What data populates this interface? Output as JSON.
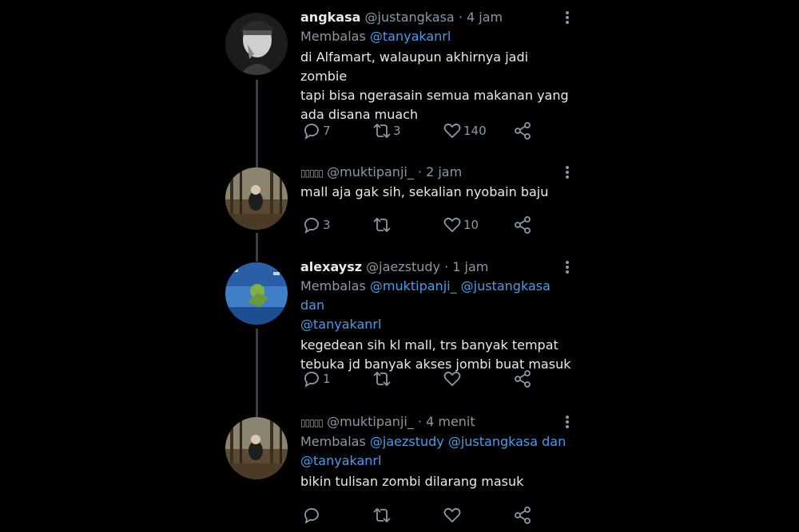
{
  "tweets": [
    {
      "name": "angkasa",
      "handle": "@justangkasa",
      "time": "· 4 jam",
      "reply_prefix": "Membalas",
      "mentions": "@tanyakanrl",
      "mentions_line2": "",
      "text_lines": [
        "di Alfamart, walaupun akhirnya jadi zombie",
        "tapi bisa ngerasain semua makanan yang",
        "ada disana muach"
      ],
      "replies": "7",
      "retweets": "3",
      "likes": "140"
    },
    {
      "name": "▯▯▯▯▯",
      "handle": "@muktipanji_",
      "time": "· 2 jam",
      "reply_prefix": "",
      "mentions": "",
      "mentions_line2": "",
      "text_lines": [
        "mall aja gak sih, sekalian nyobain baju"
      ],
      "replies": "3",
      "retweets": "",
      "likes": "10"
    },
    {
      "name": "alexaysz",
      "handle": "@jaezstudy",
      "time": "· 1 jam",
      "reply_prefix": "Membalas",
      "mentions": "@muktipanji_ @justangkasa dan",
      "mentions_line2": "@tanyakanrl",
      "text_lines": [
        "kegedean sih kl mall, trs banyak tempat",
        "tebuka jd banyak akses jombi buat masuk"
      ],
      "replies": "1",
      "retweets": "",
      "likes": ""
    },
    {
      "name": "▯▯▯▯▯",
      "handle": "@muktipanji_",
      "time": "· 4 menit",
      "reply_prefix": "Membalas",
      "mentions": "@jaezstudy @justangkasa dan",
      "mentions_line2": "@tanyakanrl",
      "text_lines": [
        "bikin tulisan zombi dilarang masuk"
      ],
      "replies": "",
      "retweets": "",
      "likes": ""
    }
  ],
  "colors": {
    "background": "#000000",
    "text": "#e7e9ea",
    "muted": "#8b98a5",
    "mention": "#4c9be8",
    "thread_line": "#3a3d41"
  },
  "icons": {
    "reply": "reply-icon",
    "retweet": "retweet-icon",
    "like": "heart-icon",
    "share": "share-icon",
    "more": "more-vertical-icon"
  }
}
